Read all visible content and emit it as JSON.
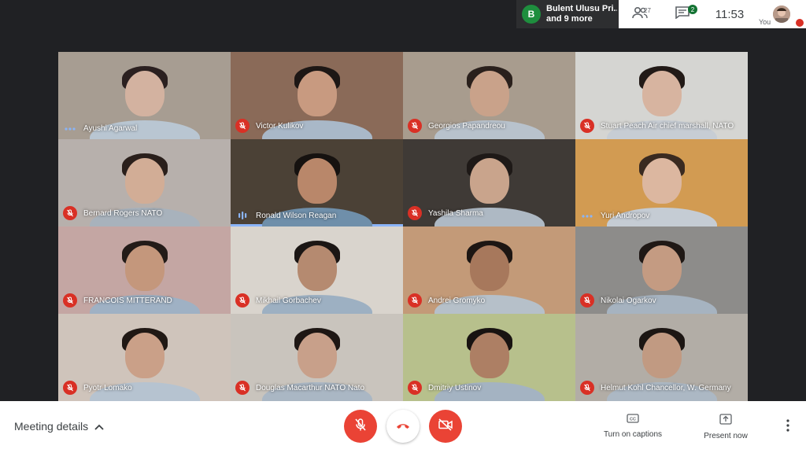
{
  "presenter": {
    "initial": "B",
    "line1": "Bulent Ulusu Pri...",
    "line2": "and 9 more"
  },
  "topbar": {
    "people_count": "27",
    "chat_badge": "2",
    "time": "11:53",
    "you_label": "You"
  },
  "participants": [
    {
      "name": "Ayushi Agarwal",
      "status": "speaking-dots",
      "bg": "#a79d92",
      "skin": "#d3b2a0",
      "hair": "#2b2020",
      "shirt": "#b9c6d2"
    },
    {
      "name": "Victor Kulikov",
      "status": "muted",
      "bg": "#8a6a58",
      "skin": "#c89a80",
      "hair": "#1d1715",
      "shirt": "#a9b8c8"
    },
    {
      "name": "Georgios Papandreou",
      "status": "muted",
      "bg": "#a89c8e",
      "skin": "#c9a28a",
      "hair": "#2a201c",
      "shirt": "#b8c2cc"
    },
    {
      "name": "Stuart Peach Air chief marshall, NATO",
      "status": "muted",
      "bg": "#d5d5d2",
      "skin": "#d7b4a0",
      "hair": "#221a17",
      "shirt": "#c7cdd4"
    },
    {
      "name": "Bernard Rogers NATO",
      "status": "muted",
      "bg": "#b7b0ac",
      "skin": "#d2ad96",
      "hair": "#2a1f1b",
      "shirt": "#a8b2bc"
    },
    {
      "name": "Ronald Wilson Reagan",
      "status": "speaking-bars",
      "bg": "#4b4136",
      "skin": "#b9876a",
      "hair": "#161210",
      "shirt": "#6f8faa"
    },
    {
      "name": "Yashila Sharma",
      "status": "muted",
      "bg": "#3f3a36",
      "skin": "#c9a48c",
      "hair": "#1e1917",
      "shirt": "#aeb9c4"
    },
    {
      "name": "Yuri Andropov",
      "status": "speaking-dots",
      "bg": "#d29b52",
      "skin": "#dcb7a0",
      "hair": "#3a2a20",
      "shirt": "#c5ccd4"
    },
    {
      "name": "FRANCOIS MITTERAND",
      "status": "muted",
      "bg": "#c4a6a3",
      "skin": "#c4977c",
      "hair": "#231b18",
      "shirt": "#9fb1c4"
    },
    {
      "name": "Mikhail Gorbachev",
      "status": "muted",
      "bg": "#d9d4cd",
      "skin": "#b58a70",
      "hair": "#1b1614",
      "shirt": "#9db0c2"
    },
    {
      "name": "Andrei Gromyko",
      "status": "muted",
      "bg": "#c39a78",
      "skin": "#a7785c",
      "hair": "#1d1613",
      "shirt": "#b6c0c9"
    },
    {
      "name": "Nikolai Ogarkov",
      "status": "muted",
      "bg": "#8d8c8a",
      "skin": "#c49b82",
      "hair": "#1f1815",
      "shirt": "#a6b3c0"
    },
    {
      "name": "Pyotr Lomako",
      "status": "muted",
      "bg": "#cfc4bb",
      "skin": "#caa088",
      "hair": "#201814",
      "shirt": "#b6c3d0"
    },
    {
      "name": "Douglas Macarthur NATO Nato",
      "status": "muted",
      "bg": "#c9c4bd",
      "skin": "#c8a08a",
      "hair": "#1e1714",
      "shirt": "#aab7c4"
    },
    {
      "name": "Dmitriy Ustinov",
      "status": "muted",
      "bg": "#b7c08c",
      "skin": "#ad7f64",
      "hair": "#181311",
      "shirt": "#a4b3c2"
    },
    {
      "name": "Helmut Kohl Chancellor, W. Germany",
      "status": "muted",
      "bg": "#b2ada6",
      "skin": "#c19a82",
      "hair": "#1c1613",
      "shirt": "#acb8c4"
    }
  ],
  "bottombar": {
    "meeting_details": "Meeting details",
    "captions_label": "Turn on captions",
    "present_label": "Present now"
  },
  "colors": {
    "background": "#202124",
    "danger": "#ea4335",
    "muted_badge": "#d93025",
    "speaking_accent": "#8ab4f8"
  }
}
